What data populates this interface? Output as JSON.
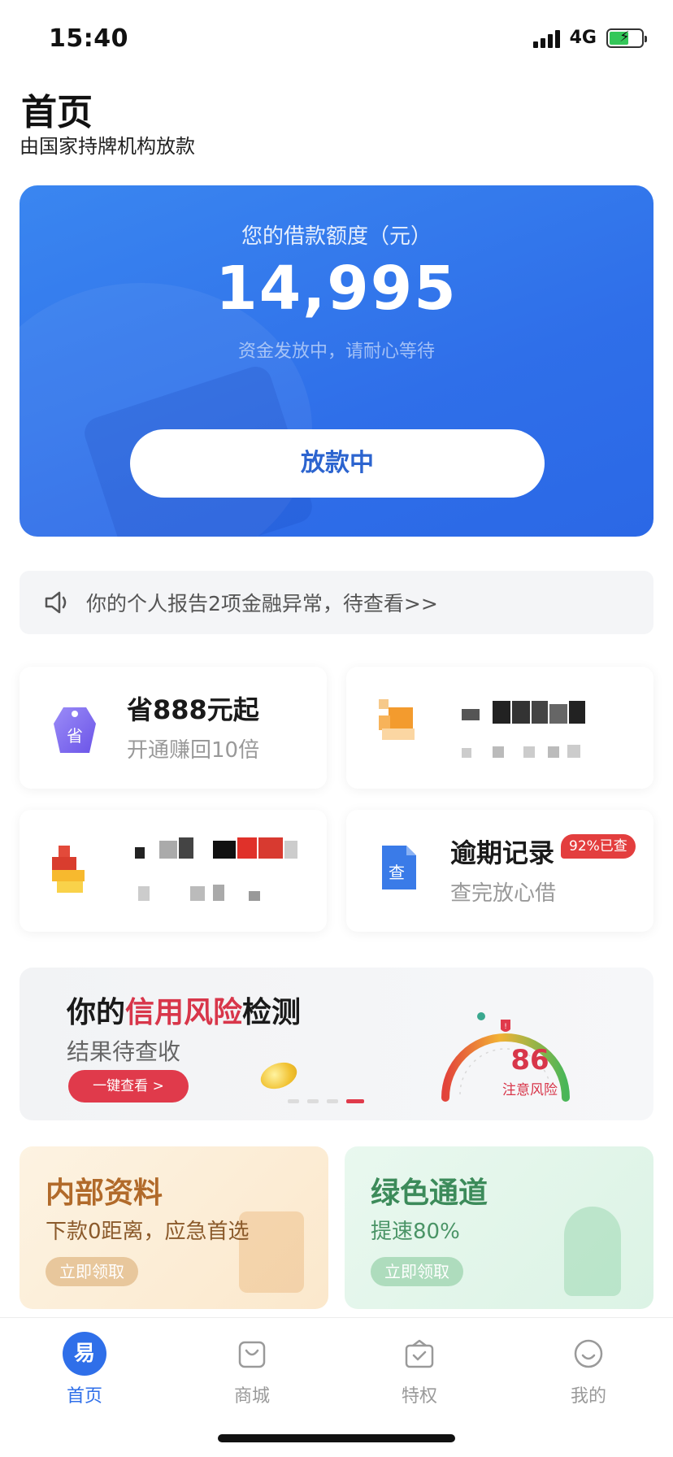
{
  "status_bar": {
    "time": "15:40",
    "network": "4G"
  },
  "header": {
    "title": "首页",
    "subtitle": "由国家持牌机构放款"
  },
  "loan_card": {
    "label": "您的借款额度（元）",
    "amount": "14,995",
    "status": "资金发放中，请耐心等待",
    "button_label": "放款中"
  },
  "notice": {
    "text": "你的个人报告2项金融异常，待查看>>"
  },
  "tiles": {
    "save": {
      "title": "省888元起",
      "subtitle": "开通赚回10倍",
      "icon_text": "省"
    },
    "overdue": {
      "title": "逾期记录",
      "subtitle": "查完放心借",
      "badge": "92%已查",
      "icon_text": "查"
    }
  },
  "risk_banner": {
    "title_prefix": "你的",
    "title_highlight": "信用风险",
    "title_suffix": "检测",
    "subtitle": "结果待查收",
    "button_label": "一键查看 >",
    "score": "86",
    "score_label": "注意风险"
  },
  "promos": {
    "internal": {
      "title": "内部资料",
      "subtitle": "下款0距离，应急首选",
      "button": "立即领取"
    },
    "green": {
      "title": "绿色通道",
      "subtitle": "提速80%",
      "button": "立即领取"
    }
  },
  "tab_bar": {
    "items": [
      {
        "label": "首页",
        "icon": "home-logo-icon",
        "icon_text": "易"
      },
      {
        "label": "商城",
        "icon": "shopping-bag-icon"
      },
      {
        "label": "特权",
        "icon": "privilege-icon"
      },
      {
        "label": "我的",
        "icon": "profile-smile-icon"
      }
    ]
  },
  "colors": {
    "primary": "#2f6fe9",
    "accent_red": "#e03a4b",
    "internal_gold": "#b16a2a",
    "green": "#3c8b5a"
  }
}
